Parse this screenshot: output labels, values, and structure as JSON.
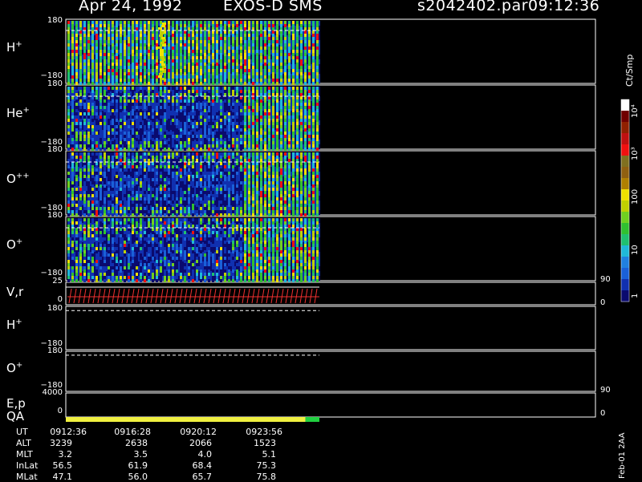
{
  "header": {
    "date": "Apr 24, 1992",
    "instrument": "EXOS-D SMS",
    "file": "s2042402.par",
    "time": "09:12:36"
  },
  "footer_id": "Feb-01 2AA",
  "colorbar": {
    "unit": "Ct/Smp",
    "colors": [
      "#0a0a6e",
      "#1030b0",
      "#1a60d8",
      "#2080e0",
      "#20b8d8",
      "#20c070",
      "#30c030",
      "#70d020",
      "#c0d000",
      "#f0e000",
      "#b08000",
      "#906010",
      "#807020",
      "#f01010",
      "#c01010",
      "#902000",
      "#700000",
      "#ffffff"
    ],
    "ticks": [
      "1",
      "10",
      "100",
      "10³",
      "10⁴"
    ],
    "tick_values": [
      1,
      10,
      100,
      1000,
      10000
    ]
  },
  "chart_data": {
    "type": "heatmap",
    "title": "Apr 24, 1992   EXOS-D SMS",
    "x_axis": {
      "label": "UT",
      "ticks": [
        "0912:36",
        "0916:28",
        "0920:12",
        "0923:56"
      ],
      "data_end": "0925:00"
    },
    "panels": [
      {
        "id": "h_plus",
        "ion": "H",
        "charge": "+",
        "kind": "spectrogram",
        "ylim": [
          -180,
          180
        ],
        "y_ticks": [
          "180",
          "−180"
        ],
        "dominant": "green-yellow",
        "notes": "enhancement near 0916"
      },
      {
        "id": "he_plus",
        "ion": "He",
        "charge": "+",
        "kind": "spectrogram",
        "ylim": [
          -180,
          180
        ],
        "y_ticks": [
          "180",
          "−180"
        ],
        "dominant": "blue"
      },
      {
        "id": "o_pp",
        "ion": "O",
        "charge": "++",
        "kind": "spectrogram",
        "ylim": [
          -180,
          180
        ],
        "y_ticks": [
          "180",
          "−180"
        ],
        "dominant": "blue"
      },
      {
        "id": "o_plus",
        "ion": "O",
        "charge": "+",
        "kind": "spectrogram",
        "ylim": [
          -180,
          180
        ],
        "y_ticks": [
          "180",
          "−180"
        ],
        "dominant": "blue"
      },
      {
        "id": "vr",
        "label": "V,r",
        "kind": "vector",
        "ylim_left": [
          0,
          25
        ],
        "y_ticks": [
          "25",
          "0"
        ],
        "right_ticks": [
          "90",
          "0"
        ]
      },
      {
        "id": "h_plus_2",
        "ion": "H",
        "charge": "+",
        "kind": "line",
        "ylim": [
          -180,
          180
        ],
        "y_ticks": [
          "180",
          "−180"
        ],
        "level": 145
      },
      {
        "id": "o_plus_2",
        "ion": "O",
        "charge": "+",
        "kind": "line",
        "ylim": [
          -180,
          180
        ],
        "y_ticks": [
          "180",
          "−180"
        ],
        "level": 145
      },
      {
        "id": "ep",
        "label": "E,p",
        "kind": "empty",
        "y_ticks": [
          "4000",
          "0"
        ],
        "right_ticks": [
          "90",
          "0"
        ]
      },
      {
        "id": "qa",
        "label": "QA",
        "kind": "bar",
        "segments": [
          {
            "from": "0912:36",
            "to": "0924:00",
            "color": "#f0f040"
          },
          {
            "from": "0924:00",
            "to": "0924:40",
            "color": "#20d040"
          }
        ]
      }
    ]
  },
  "ephemeris": {
    "rows": [
      {
        "label": "UT",
        "values": [
          "0912:36",
          "0916:28",
          "0920:12",
          "0923:56"
        ]
      },
      {
        "label": "ALT",
        "values": [
          "3239",
          "2638",
          "2066",
          "1523"
        ]
      },
      {
        "label": "MLT",
        "values": [
          "3.2",
          "3.5",
          "4.0",
          "5.1"
        ]
      },
      {
        "label": "InLat",
        "values": [
          "56.5",
          "61.9",
          "68.4",
          "75.3"
        ]
      },
      {
        "label": "MLat",
        "values": [
          "47.1",
          "56.0",
          "65.7",
          "75.8"
        ]
      }
    ]
  }
}
